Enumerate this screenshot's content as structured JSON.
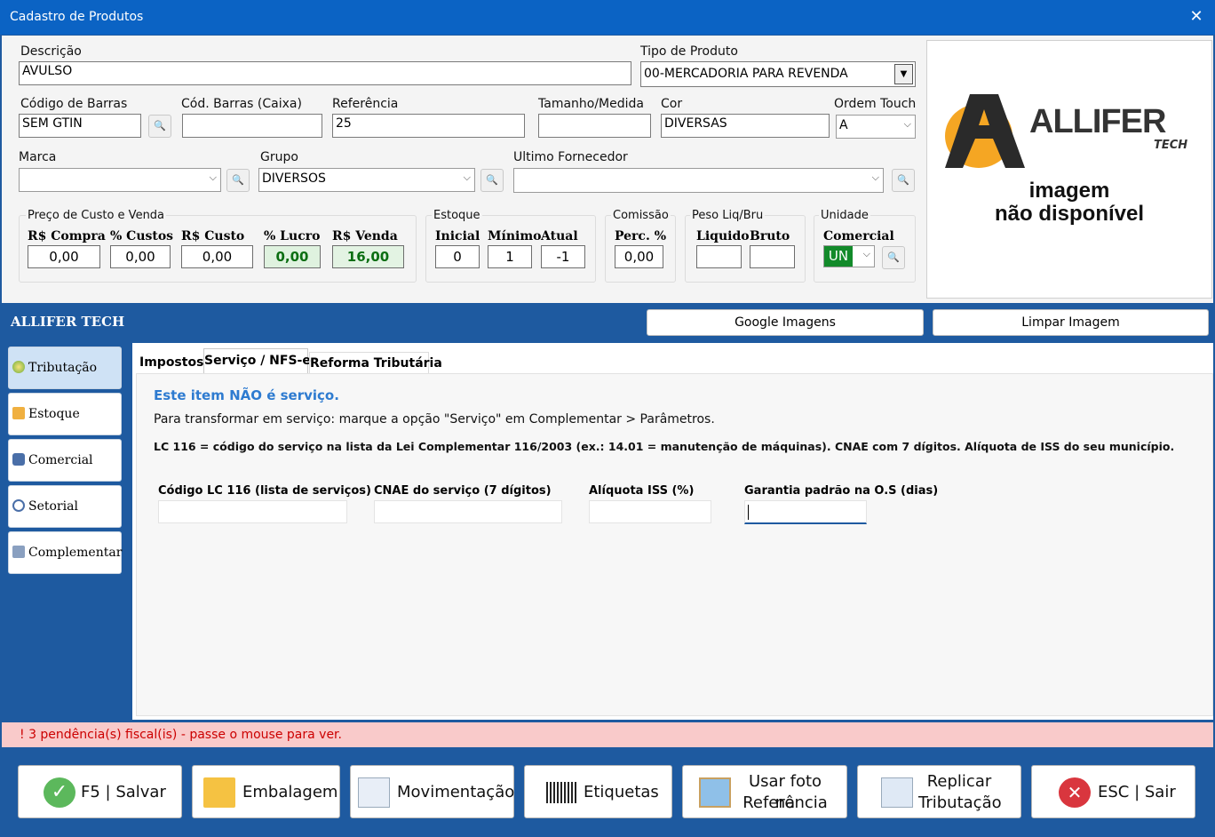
{
  "window": {
    "title": "Cadastro de Produtos",
    "close_glyph": "✕"
  },
  "form": {
    "descricao": {
      "label": "Descrição",
      "value": "AVULSO"
    },
    "tipo_produto": {
      "label": "Tipo de Produto",
      "value": "00-MERCADORIA PARA REVENDA"
    },
    "codigo_barras": {
      "label": "Código de Barras",
      "value": "SEM GTIN"
    },
    "cod_barras_caixa": {
      "label": "Cód. Barras (Caixa)",
      "value": ""
    },
    "referencia": {
      "label": "Referência",
      "value": "25"
    },
    "tamanho_medida": {
      "label": "Tamanho/Medida",
      "value": ""
    },
    "cor": {
      "label": "Cor",
      "value": "DIVERSAS"
    },
    "ordem_touch": {
      "label": "Ordem Touch",
      "value": "A"
    },
    "marca": {
      "label": "Marca",
      "value": ""
    },
    "grupo": {
      "label": "Grupo",
      "value": "DIVERSOS"
    },
    "ultimo_fornecedor": {
      "label": "Ultimo Fornecedor",
      "value": ""
    }
  },
  "preco": {
    "group_label": "Preço de Custo e Venda",
    "compra": {
      "label": "R$ Compra",
      "value": "0,00"
    },
    "custos": {
      "label": "% Custos",
      "value": "0,00"
    },
    "custo": {
      "label": "R$ Custo",
      "value": "0,00"
    },
    "lucro": {
      "label": "% Lucro",
      "value": "0,00"
    },
    "venda": {
      "label": "R$ Venda",
      "value": "16,00"
    }
  },
  "estoque": {
    "group_label": "Estoque",
    "inicial": {
      "label": "Inicial",
      "value": "0"
    },
    "minimo": {
      "label": "Mínimo",
      "value": "1"
    },
    "atual": {
      "label": "Atual",
      "value": "-1"
    }
  },
  "comissao": {
    "group_label": "Comissão",
    "perc": {
      "label": "Perc. %",
      "value": "0,00"
    }
  },
  "peso": {
    "group_label": "Peso Liq/Bru",
    "liquido": {
      "label": "Liquido",
      "value": ""
    },
    "bruto": {
      "label": "Bruto",
      "value": ""
    }
  },
  "unidade": {
    "group_label": "Unidade",
    "comercial": {
      "label": "Comercial",
      "value": "UN"
    }
  },
  "image_panel": {
    "logo_text": "ALLIFER",
    "logo_sub": "TECH",
    "msg_line1": "imagem",
    "msg_line2": "não disponível"
  },
  "bluebar": {
    "brand": "ALLIFER TECH",
    "google_btn": "Google Imagens",
    "clear_btn": "Limpar Imagem"
  },
  "sidebar": {
    "items": [
      {
        "label": "Tributação",
        "icon": "coin-icon"
      },
      {
        "label": "Estoque",
        "icon": "pencil-box-icon"
      },
      {
        "label": "Comercial",
        "icon": "tag-icon"
      },
      {
        "label": "Setorial",
        "icon": "gauge-icon"
      },
      {
        "label": "Complementar",
        "icon": "settings-icon"
      }
    ]
  },
  "tabs": [
    {
      "label": "Impostos"
    },
    {
      "label": "Serviço / NFS-e"
    },
    {
      "label": "Reforma Tributária"
    }
  ],
  "servico": {
    "heading": "Este item NÃO é serviço.",
    "instruction": "Para transformar em serviço: marque a opção \"Serviço\" em Complementar > Parâmetros.",
    "note": "LC 116 = código do serviço na lista da Lei Complementar 116/2003 (ex.: 14.01 = manutenção de máquinas). CNAE com 7 dígitos. Alíquota de ISS do seu município.",
    "lc116": {
      "label": "Código LC 116 (lista de serviços)",
      "value": ""
    },
    "cnae": {
      "label": "CNAE do serviço (7 dígitos)",
      "value": ""
    },
    "aliquota": {
      "label": "Alíquota ISS (%)",
      "value": ""
    },
    "garantia": {
      "label": "Garantia padrão na O.S (dias)",
      "value": ""
    }
  },
  "pendencia": "! 3 pendência(s) fiscal(is) - passe o mouse para ver.",
  "footer": {
    "salvar": "F5 | Salvar",
    "embalagem": "Embalagem",
    "movimentacao": "Movimentação",
    "etiquetas": "Etiquetas",
    "usar_foto_1": "Usar foto na",
    "usar_foto_2": "Referência",
    "replicar_1": "Replicar",
    "replicar_2": "Tributação",
    "sair": "ESC | Sair"
  },
  "colors": {
    "titlebar": "#0b63c4",
    "panel_blue": "#1e5aa0",
    "accent_green": "#0b6e12",
    "unit_green": "#128a2a",
    "pending_bg": "#f9caca",
    "logo_orange": "#f5a623"
  }
}
